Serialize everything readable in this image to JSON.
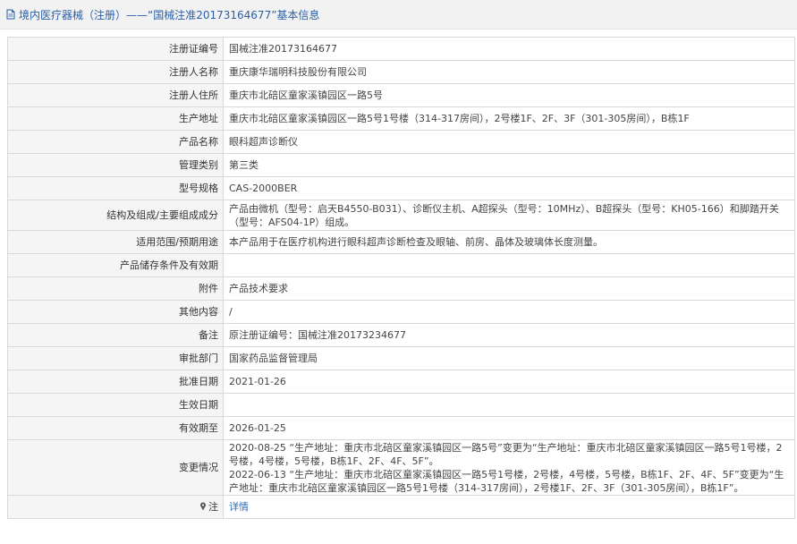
{
  "header": {
    "title": "境内医疗器械（注册）——“国械注准20173164677”基本信息"
  },
  "fields": [
    {
      "label": "注册证编号",
      "value": "国械注准20173164677"
    },
    {
      "label": "注册人名称",
      "value": "重庆康华瑞明科技股份有限公司"
    },
    {
      "label": "注册人住所",
      "value": "重庆市北碚区童家溪镇园区一路5号"
    },
    {
      "label": "生产地址",
      "value": "重庆市北碚区童家溪镇园区一路5号1号楼（314-317房间），2号楼1F、2F、3F（301-305房间），B栋1F"
    },
    {
      "label": "产品名称",
      "value": "眼科超声诊断仪"
    },
    {
      "label": "管理类别",
      "value": "第三类"
    },
    {
      "label": "型号规格",
      "value": "CAS-2000BER"
    },
    {
      "label": "结构及组成/主要组成成分",
      "value": "产品由微机（型号：启天B4550-B031）、诊断仪主机、A超探头（型号：10MHz）、B超探头（型号：KH05-166）和脚踏开关（型号：AFS04-1P）组成。"
    },
    {
      "label": "适用范围/预期用途",
      "value": "本产品用于在医疗机构进行眼科超声诊断检查及眼轴、前房、晶体及玻璃体长度测量。"
    },
    {
      "label": "产品储存条件及有效期",
      "value": ""
    },
    {
      "label": "附件",
      "value": "产品技术要求"
    },
    {
      "label": "其他内容",
      "value": "/"
    },
    {
      "label": "备注",
      "value": "原注册证编号：国械注准20173234677"
    },
    {
      "label": "审批部门",
      "value": "国家药品监督管理局"
    },
    {
      "label": "批准日期",
      "value": "2021-01-26"
    },
    {
      "label": "生效日期",
      "value": ""
    },
    {
      "label": "有效期至",
      "value": "2026-01-25"
    }
  ],
  "changes": {
    "label": "变更情况",
    "entries": [
      "2020-08-25 “生产地址：重庆市北碚区童家溪镇园区一路5号”变更为“生产地址：重庆市北碚区童家溪镇园区一路5号1号楼，2号楼，4号楼，5号楼，B栋1F、2F、4F、5F”。",
      "2022-06-13 “生产地址：重庆市北碚区童家溪镇园区一路5号1号楼，2号楼，4号楼，5号楼，B栋1F、2F、4F、5F”变更为“生产地址：重庆市北碚区童家溪镇园区一路5号1号楼（314-317房间），2号楼1F、2F、3F（301-305房间），B栋1F”。"
    ]
  },
  "note": {
    "label": "注",
    "link": "详情"
  }
}
